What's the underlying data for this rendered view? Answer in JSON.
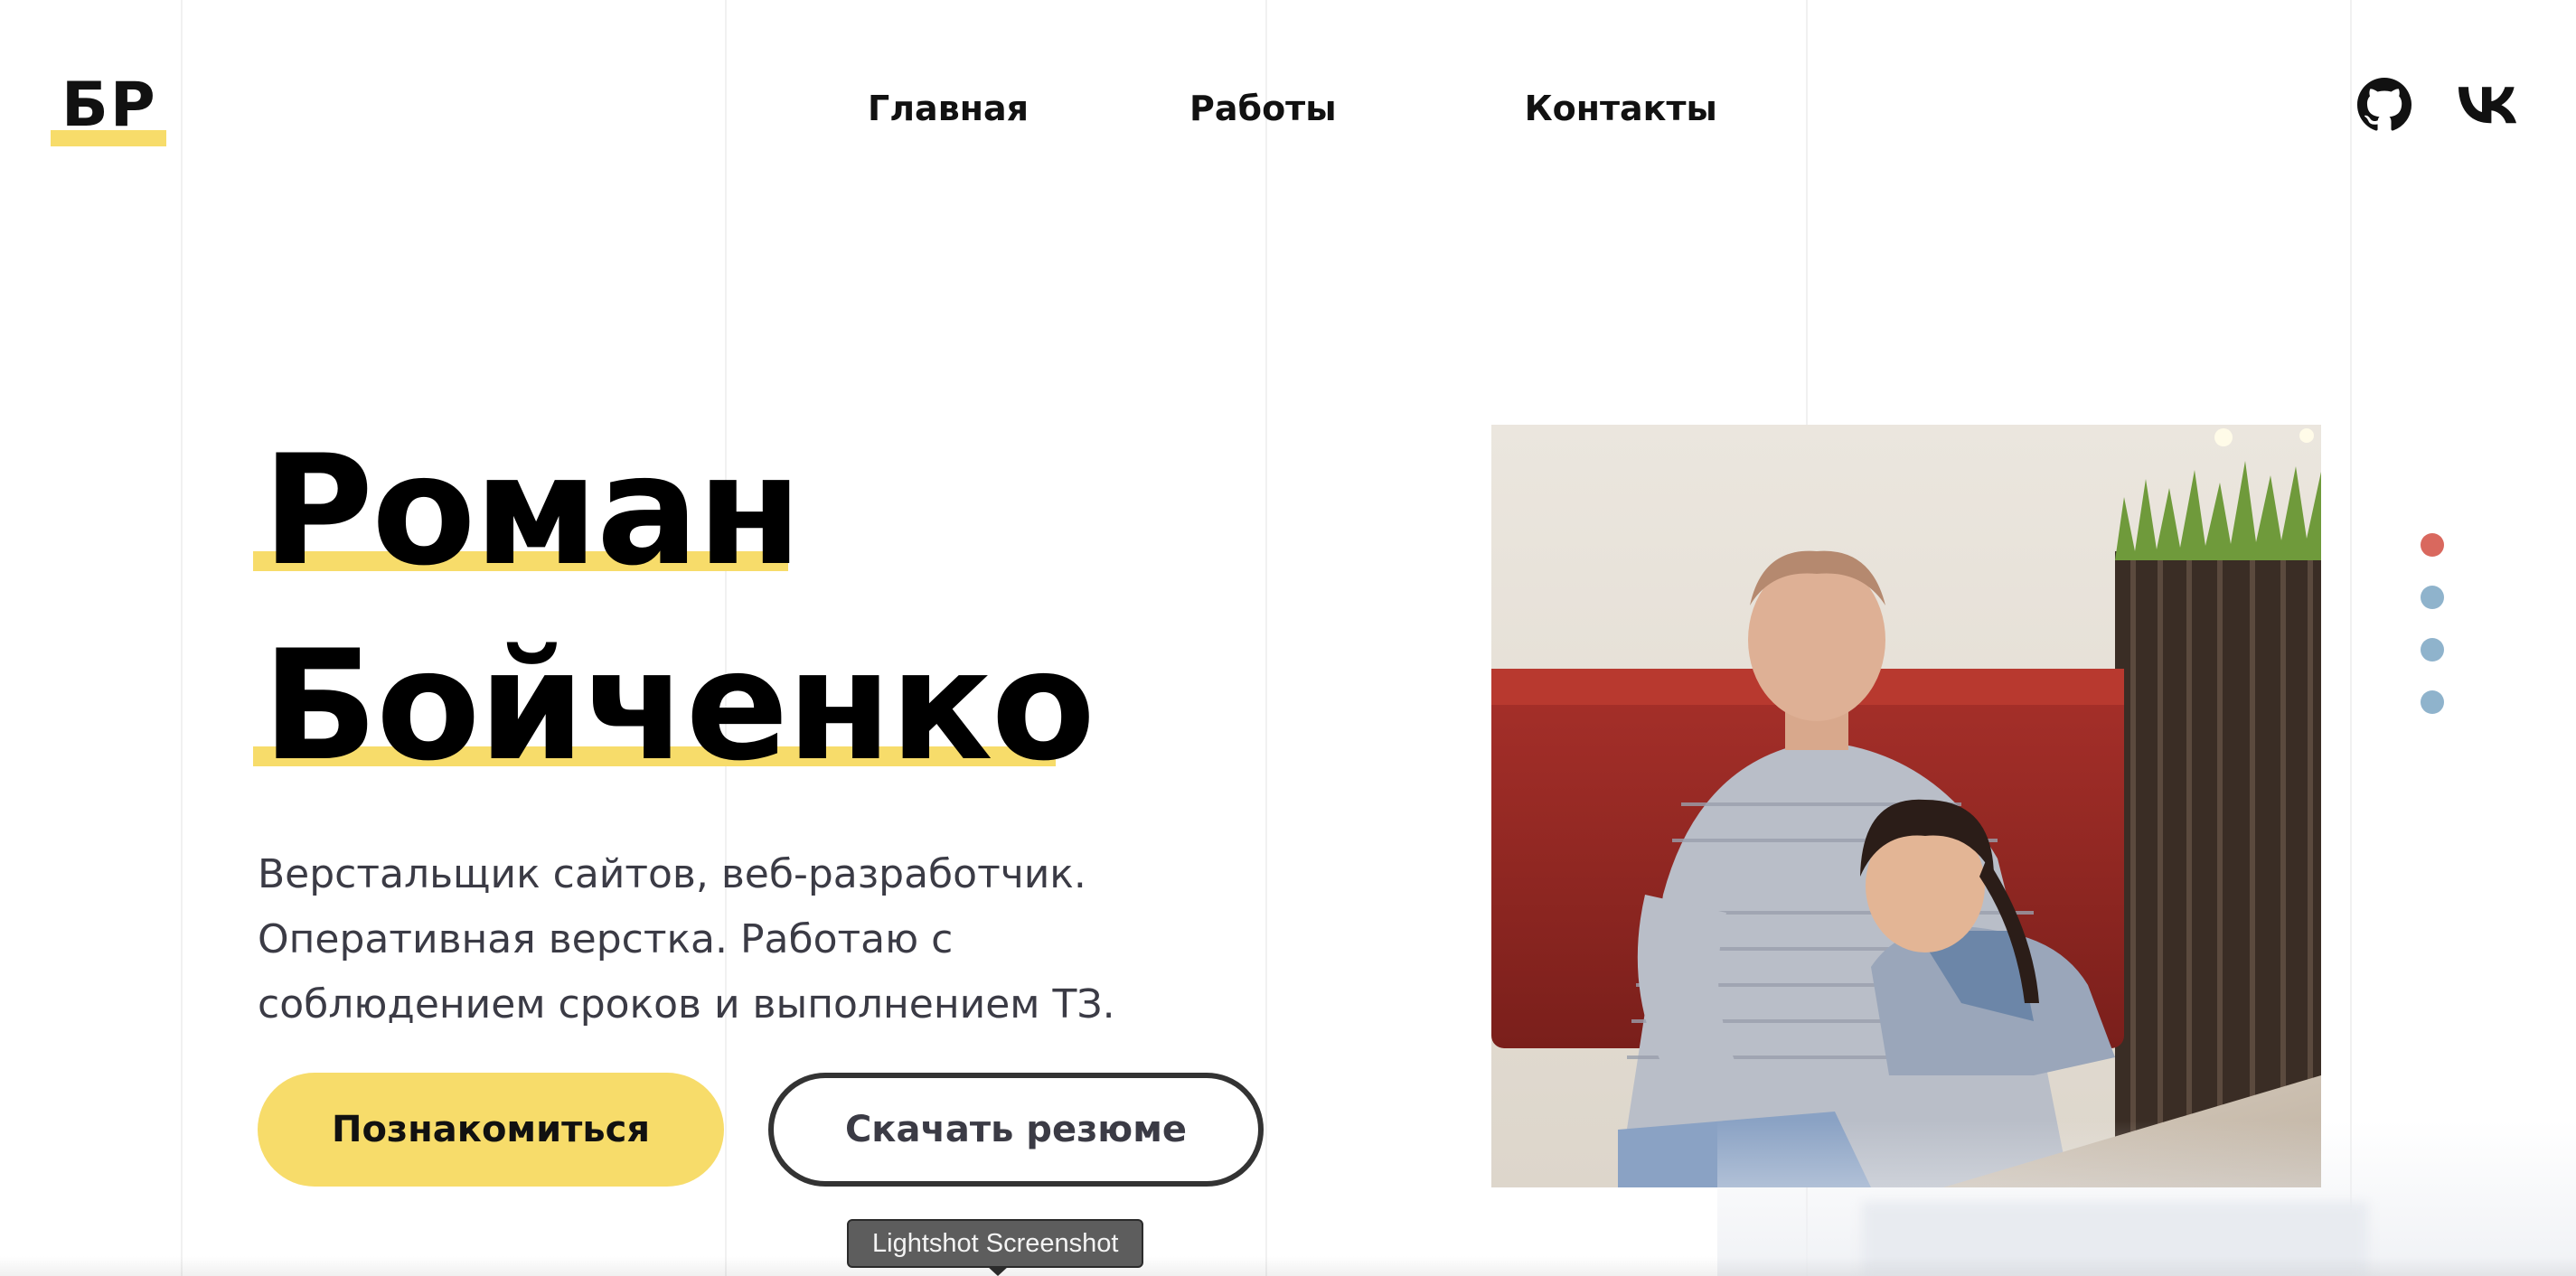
{
  "header": {
    "logo_text": "БР",
    "nav": [
      {
        "label": "Главная",
        "active": true
      },
      {
        "label": "Работы",
        "active": false
      },
      {
        "label": "Контакты",
        "active": false
      }
    ],
    "social": [
      {
        "icon": "github-icon"
      },
      {
        "icon": "vk-icon"
      }
    ]
  },
  "hero": {
    "first_name": "Роман",
    "last_name": "Бойченко",
    "description_lines": [
      "Верстальщик сайтов, веб-разработчик.",
      "Оперативная верстка. Работаю с",
      "соблюдением сроков и выполнением ТЗ."
    ],
    "primary_button": "Познакомиться",
    "secondary_button": "Скачать резюме",
    "photo_icon": "portrait-photo"
  },
  "slider": {
    "count": 4,
    "active_index": 0
  },
  "tooltip": {
    "text": "Lightshot Screenshot"
  },
  "colors": {
    "accent_yellow": "#f7dc6a",
    "text_dark": "#111111",
    "text_muted": "#3b3b45",
    "dot_active": "#d9685e",
    "dot_inactive": "#8fb3cc"
  }
}
